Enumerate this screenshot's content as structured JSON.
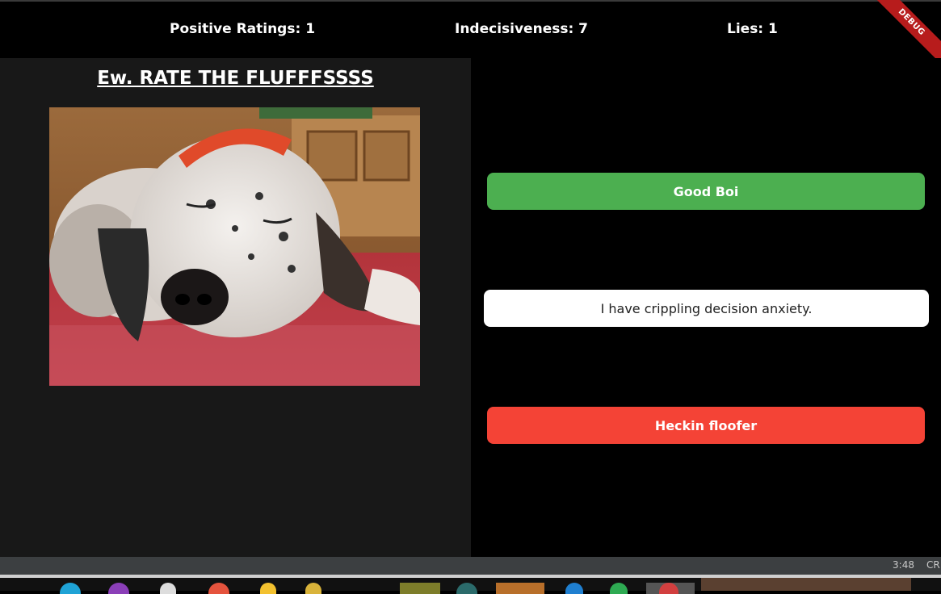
{
  "stats": {
    "positive": "Positive Ratings: 1",
    "indecisiveness": "Indecisiveness: 7",
    "lies": "Lies: 1"
  },
  "debug_banner": "DEBUG",
  "main": {
    "title": "Ew. RATE THE FLUFFFSSSS"
  },
  "buttons": {
    "good": "Good Boi",
    "anxiety": "I have crippling decision anxiety.",
    "floofer": "Heckin floofer"
  },
  "colors": {
    "good": "#4caf50",
    "floofer": "#f44336",
    "anxiety": "#ffffff",
    "left_panel": "#181818",
    "debug": "#b71c1c"
  },
  "statusbar": {
    "time": "3:48",
    "extra": "CR"
  },
  "taskbar_icons": [
    "ie-icon",
    "browser-icon",
    "notepad-icon",
    "chrome-icon",
    "folder-icon",
    "files-icon",
    "app-red-icon",
    "terminal-icon",
    "app-orange-icon",
    "file-icon",
    "vscode-icon",
    "app-green-icon",
    "app-gray-icon",
    "app-red2-icon"
  ]
}
